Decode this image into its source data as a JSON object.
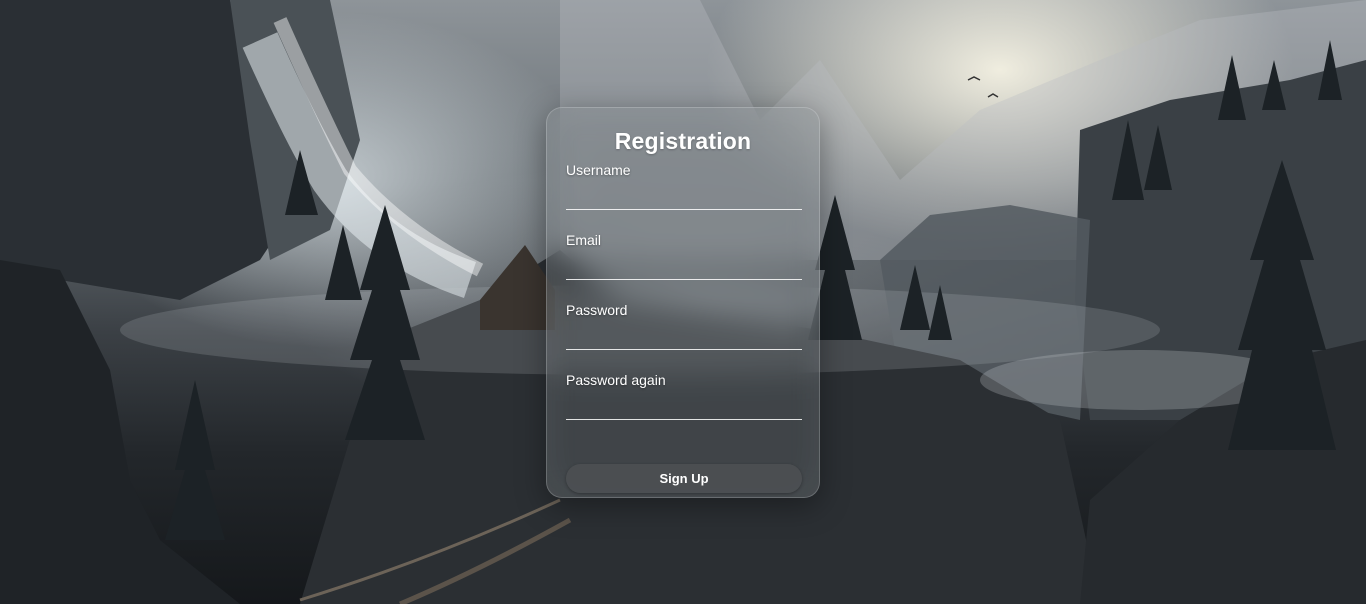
{
  "form": {
    "title": "Registration",
    "fields": [
      {
        "label": "Username",
        "value": ""
      },
      {
        "label": "Email",
        "value": ""
      },
      {
        "label": "Password",
        "value": ""
      },
      {
        "label": "Password again",
        "value": ""
      }
    ],
    "submit_label": "Sign Up"
  },
  "colors": {
    "card_text": "#ffffff",
    "button_bg": "#4e5054"
  }
}
